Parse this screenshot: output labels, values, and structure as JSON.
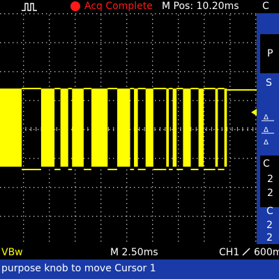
{
  "status": {
    "acquisition_state": "Acq Complete",
    "main_position": "M Pos: 10.20ms",
    "menu_corner_text": "C",
    "acq_indicator_color": "#ff1a1a",
    "trigger_icon": "trigger-rising-edge-icon"
  },
  "colors": {
    "ch1_trace": "#ffff00",
    "menu_background": "#1a3aa8",
    "graticule": "#bfbfbf",
    "screen_background": "#000000"
  },
  "side_menu": {
    "fragment_top_right": "P",
    "fragment_mid": "S",
    "fragment_box_1": "C",
    "fragment_box_2": "2",
    "fragment_box_3": "2",
    "fragment_lower_1": "C",
    "fragment_lower_2": "2",
    "fragment_lower_3": "2"
  },
  "readouts": {
    "ch1_scale_fragment": "VBw",
    "timebase": "M 2.50ms",
    "trigger_channel": "CH1",
    "trigger_slope_icon": "rising-slope-icon",
    "trigger_level_fragment": "600m"
  },
  "message": {
    "text": "purpose knob to move Cursor 1"
  },
  "waveform": {
    "channel": "CH1",
    "high_level_div": 1.4,
    "low_level_div": -1.3,
    "idle_level_div": 0.0,
    "pulse_bursts_time_div": [
      [
        0.0,
        0.95
      ],
      [
        1.7,
        2.22
      ],
      [
        2.45,
        2.75
      ],
      [
        2.9,
        3.35
      ],
      [
        3.65,
        4.28
      ],
      [
        4.65,
        5.15
      ],
      [
        5.3,
        5.45
      ],
      [
        5.75,
        6.05
      ],
      [
        6.55,
        6.65
      ],
      [
        6.8,
        6.95
      ],
      [
        7.2,
        7.5
      ],
      [
        7.8,
        8.0
      ],
      [
        8.45,
        8.55
      ],
      [
        8.8,
        8.9
      ]
    ],
    "end_time_div": 10.0
  }
}
